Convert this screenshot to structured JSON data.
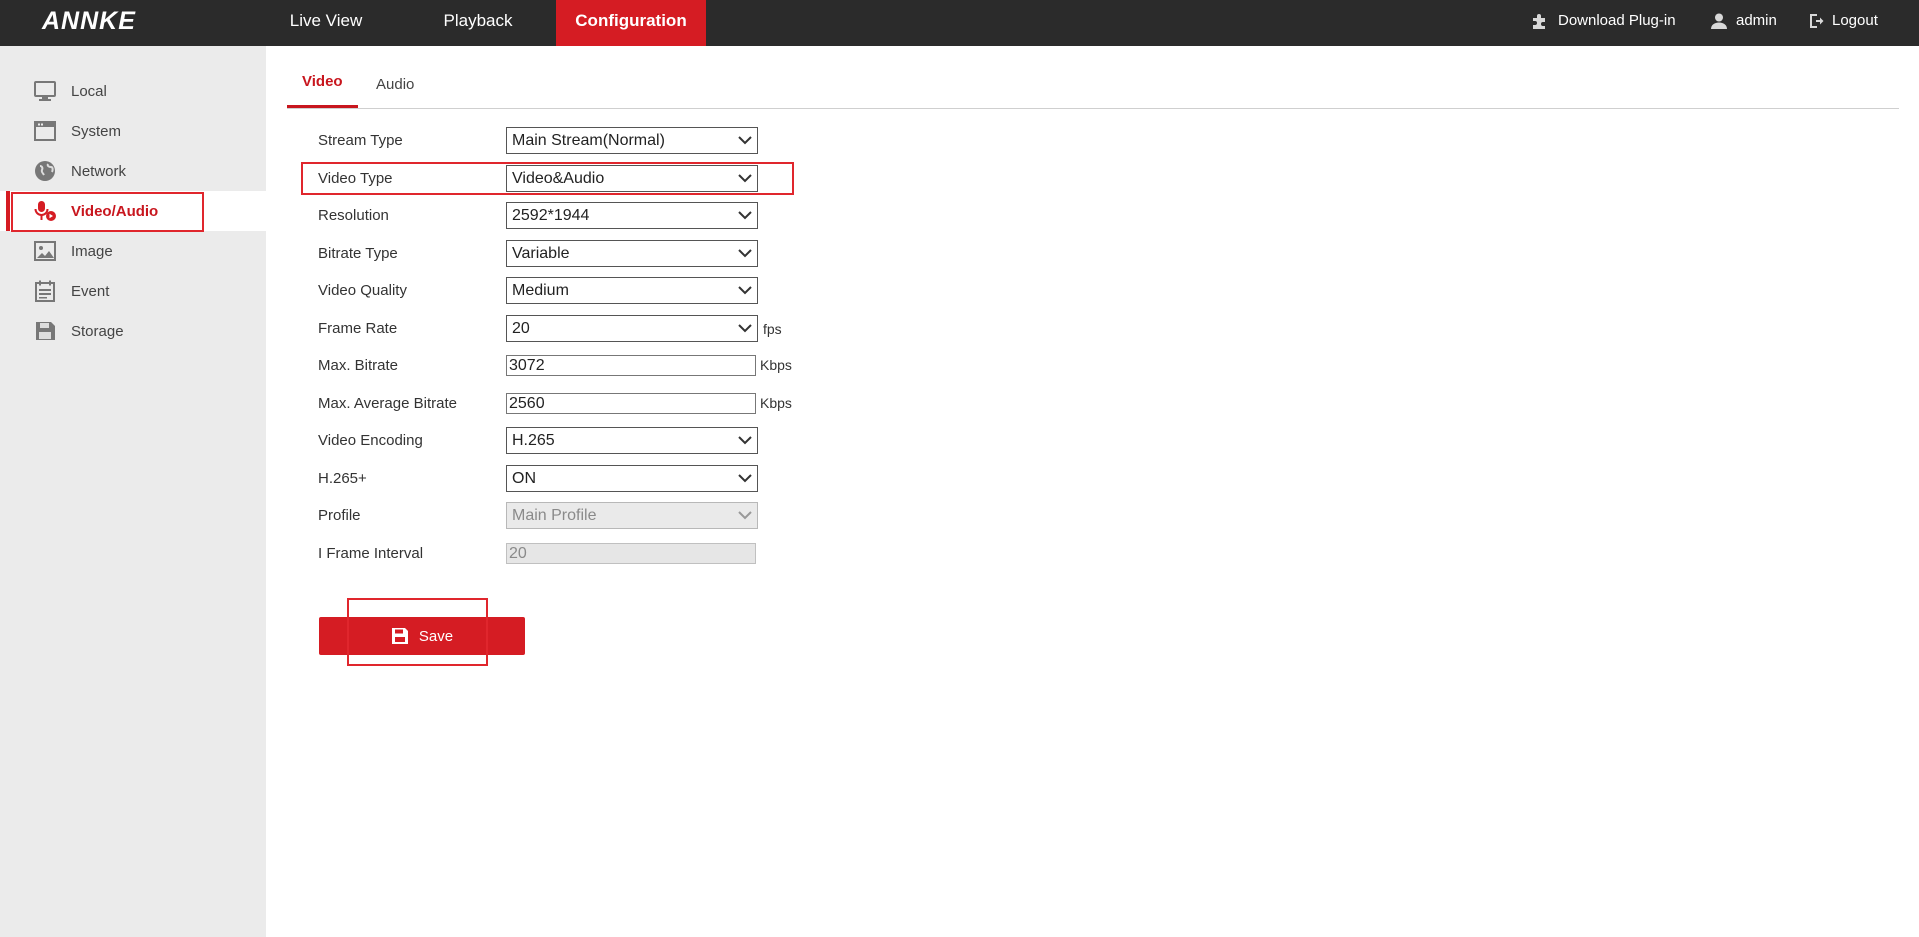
{
  "app": {
    "logo": "ANNKE"
  },
  "topnav": {
    "items": [
      "Live View",
      "Playback",
      "Configuration"
    ],
    "active": "Configuration"
  },
  "topright": {
    "plugin": "Download Plug-in",
    "user": "admin",
    "logout": "Logout"
  },
  "sidebar": {
    "items": [
      {
        "label": "Local",
        "icon": "monitor-icon"
      },
      {
        "label": "System",
        "icon": "system-window-icon"
      },
      {
        "label": "Network",
        "icon": "globe-icon"
      },
      {
        "label": "Video/Audio",
        "icon": "microphone-icon"
      },
      {
        "label": "Image",
        "icon": "image-icon"
      },
      {
        "label": "Event",
        "icon": "calendar-icon"
      },
      {
        "label": "Storage",
        "icon": "floppy-disk-icon"
      }
    ],
    "active": "Video/Audio"
  },
  "tabs": {
    "video": "Video",
    "audio": "Audio",
    "active": "Video"
  },
  "form": {
    "stream_type": {
      "label": "Stream Type",
      "value": "Main Stream(Normal)"
    },
    "video_type": {
      "label": "Video Type",
      "value": "Video&Audio"
    },
    "resolution": {
      "label": "Resolution",
      "value": "2592*1944"
    },
    "bitrate_type": {
      "label": "Bitrate Type",
      "value": "Variable"
    },
    "video_quality": {
      "label": "Video Quality",
      "value": "Medium"
    },
    "frame_rate": {
      "label": "Frame Rate",
      "value": "20",
      "unit": "fps"
    },
    "max_bitrate": {
      "label": "Max. Bitrate",
      "value": "3072",
      "unit": "Kbps"
    },
    "max_avg_bitrate": {
      "label": "Max. Average Bitrate",
      "value": "2560",
      "unit": "Kbps"
    },
    "video_encoding": {
      "label": "Video Encoding",
      "value": "H.265"
    },
    "h265plus": {
      "label": "H.265+",
      "value": "ON"
    },
    "profile": {
      "label": "Profile",
      "value": "Main Profile",
      "disabled": true
    },
    "i_frame_interval": {
      "label": "I Frame Interval",
      "value": "20",
      "disabled": true
    }
  },
  "actions": {
    "save": "Save"
  },
  "colors": {
    "accent": "#d51c23",
    "topbar": "#2b2b2b",
    "sidebar": "#ebebeb"
  }
}
